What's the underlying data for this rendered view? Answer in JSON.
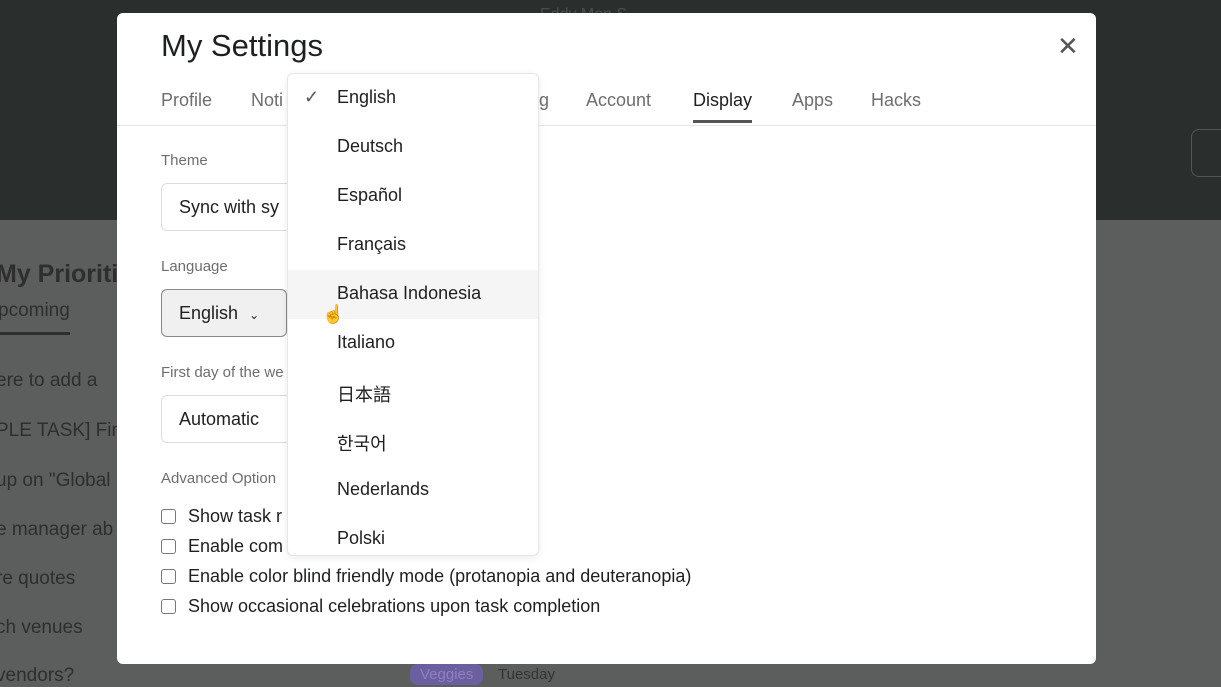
{
  "background": {
    "title": "Eddy Mon S",
    "heading": "My Prioriti",
    "tab": "pcoming",
    "rows": [
      "ere to add a",
      "PLE TASK] Fin",
      "up on \"Global",
      "e manager ab",
      "re quotes",
      "ch venues",
      "vendors?"
    ],
    "tag": "Veggies",
    "tag_color": "#6c5fa0",
    "due": "Tuesday"
  },
  "modal": {
    "title": "My Settings",
    "tabs": [
      "Profile",
      "Noti",
      "g",
      "Account",
      "Display",
      "Apps",
      "Hacks"
    ],
    "active_tab": "Display",
    "theme": {
      "label": "Theme",
      "value": "Sync with sy"
    },
    "language": {
      "label": "Language",
      "value": "English"
    },
    "first_day": {
      "label": "First day of the we",
      "value": "Automatic"
    },
    "advanced": {
      "label": "Advanced Option",
      "options": [
        "Show task r",
        "Enable com",
        "Enable color blind friendly mode (protanopia and deuteranopia)",
        "Show occasional celebrations upon task completion"
      ]
    }
  },
  "dropdown": {
    "selected": "English",
    "hovered": "Bahasa Indonesia",
    "options": [
      "English",
      "Deutsch",
      "Español",
      "Français",
      "Bahasa Indonesia",
      "Italiano",
      "日本語",
      "한국어",
      "Nederlands",
      "Polski"
    ]
  }
}
